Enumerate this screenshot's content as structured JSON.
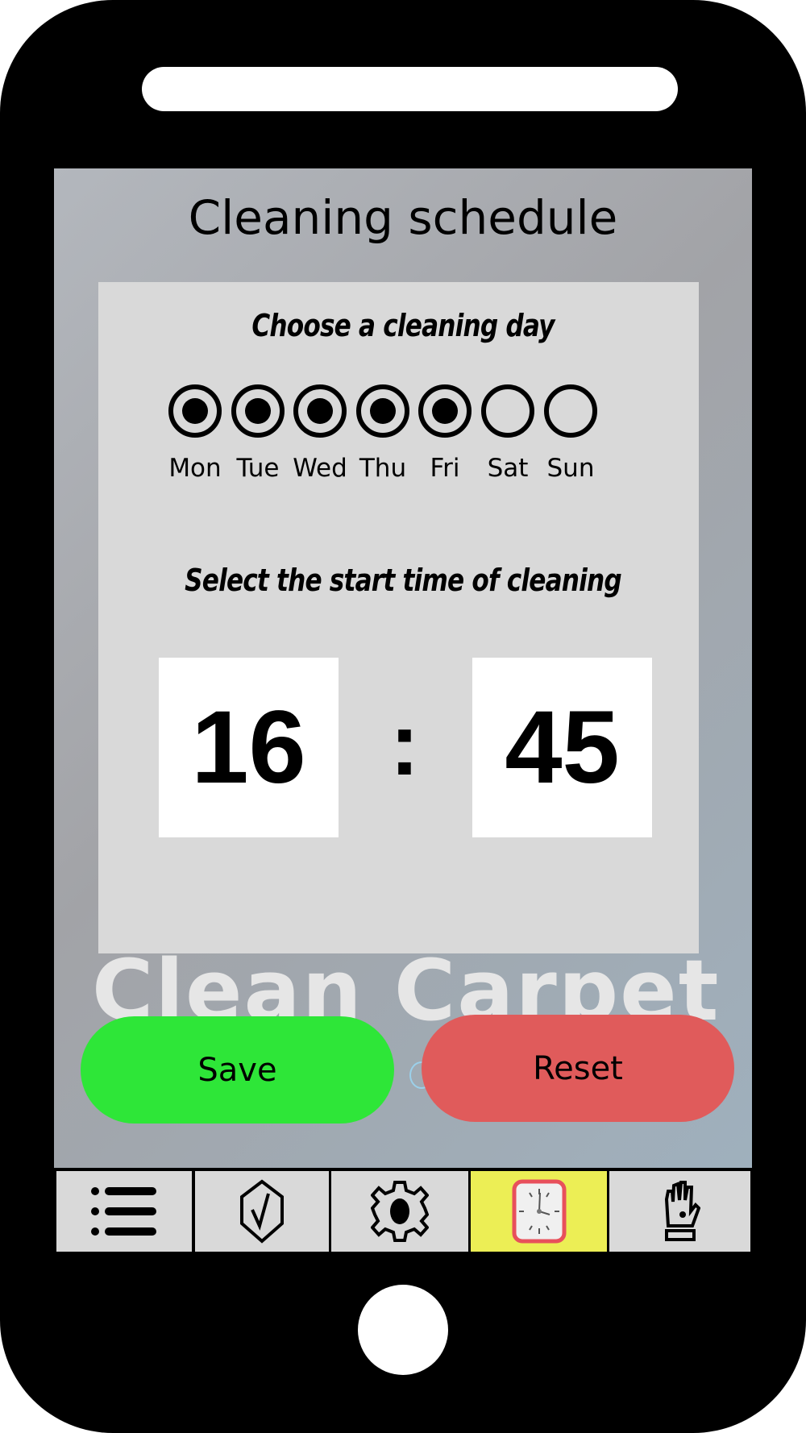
{
  "header": {
    "title": "Cleaning schedule"
  },
  "day_section": {
    "heading": "Choose a cleaning day",
    "days": [
      {
        "label": "Mon",
        "selected": true
      },
      {
        "label": "Tue",
        "selected": true
      },
      {
        "label": "Wed",
        "selected": true
      },
      {
        "label": "Thu",
        "selected": true
      },
      {
        "label": "Fri",
        "selected": true
      },
      {
        "label": "Sat",
        "selected": false
      },
      {
        "label": "Sun",
        "selected": false
      }
    ]
  },
  "time_section": {
    "heading": "Select the start time of cleaning",
    "hours": "16",
    "separator": ":",
    "minutes": "45"
  },
  "brand": "Clean Carpet",
  "buttons": {
    "save": "Save",
    "reset": "Reset",
    "save_color": "#2ee638",
    "reset_color": "#e05b5b"
  },
  "nav": {
    "items": [
      {
        "icon": "list-icon",
        "active": false
      },
      {
        "icon": "shield-check-icon",
        "active": false
      },
      {
        "icon": "gear-icon",
        "active": false
      },
      {
        "icon": "clock-icon",
        "active": true
      },
      {
        "icon": "glove-icon",
        "active": false
      }
    ],
    "active_color": "#ecee55"
  }
}
